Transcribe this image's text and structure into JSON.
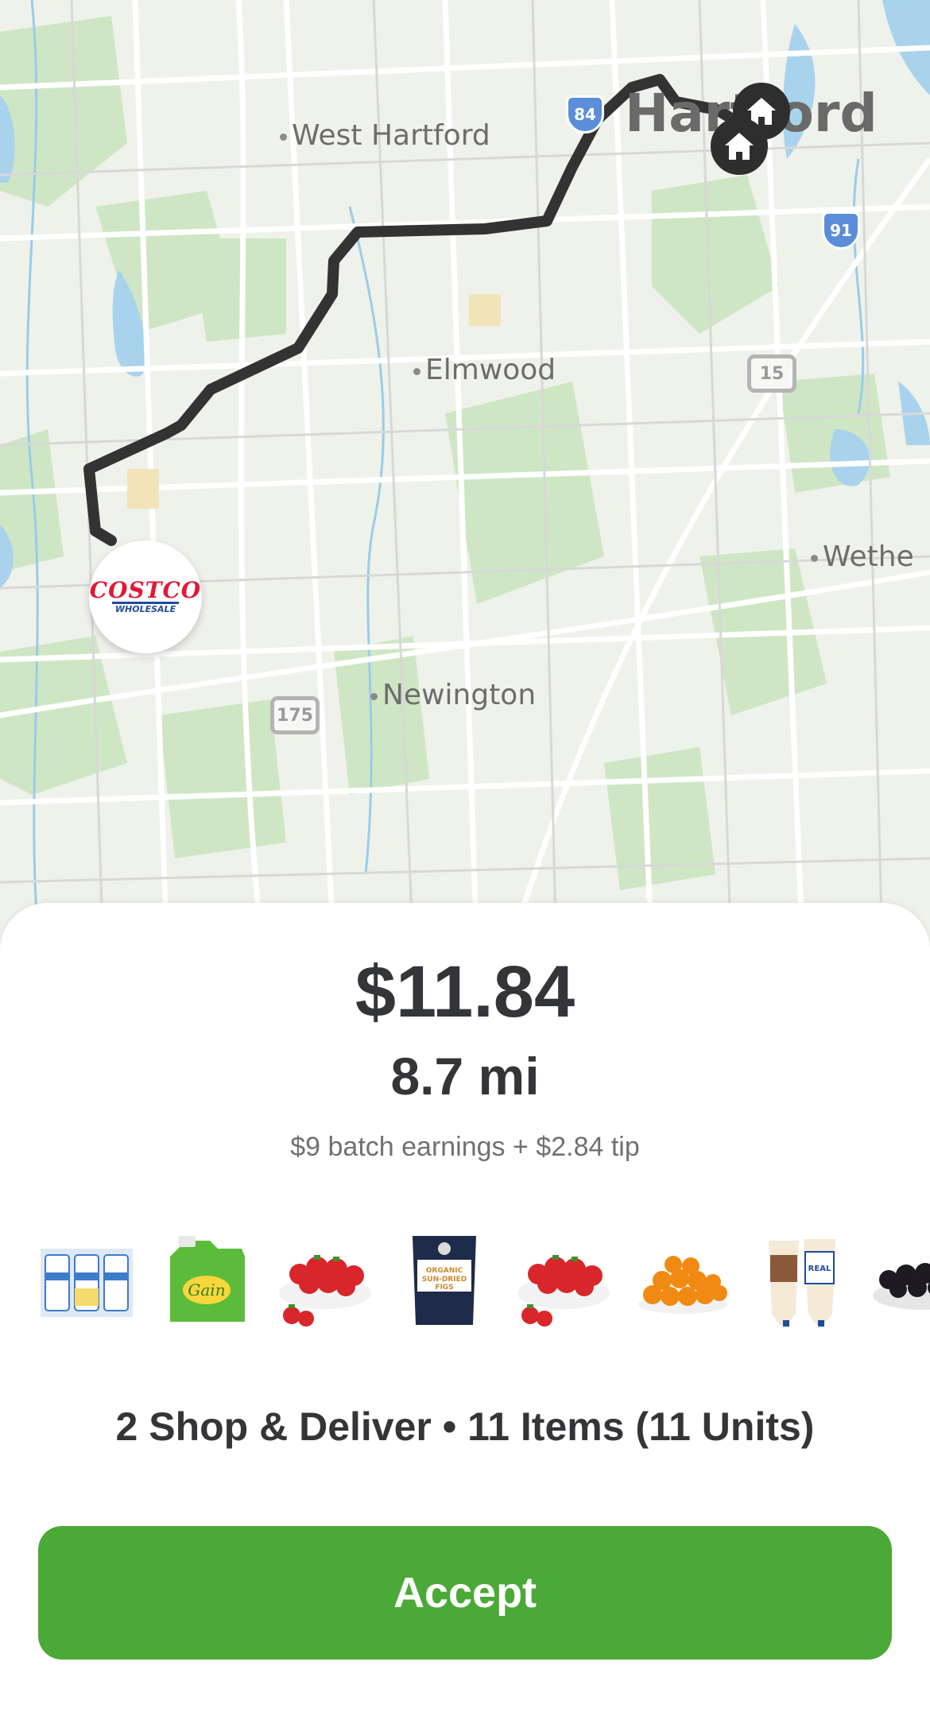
{
  "map": {
    "places": {
      "west_hartford": "West Hartford",
      "hartford": "Hartford",
      "elmwood": "Elmwood",
      "wethersfield": "Wethe",
      "newington": "Newington"
    },
    "route_shields": {
      "rt15": "15",
      "rt175": "175",
      "i91": "91",
      "i84": "84"
    },
    "store_logo": {
      "main": "COSTCO",
      "sub": "WHOLESALE"
    },
    "colors": {
      "route": "#333333",
      "water": "#a9d3ec",
      "park": "#c8e2bf"
    }
  },
  "offer": {
    "amount": "$11.84",
    "distance": "8.7 mi",
    "breakdown": "$9 batch earnings + $2.84 tip",
    "items": [
      {
        "icon": "cetaphil-lotion-pack-icon"
      },
      {
        "icon": "gain-detergent-icon"
      },
      {
        "icon": "strawberries-bowl-icon"
      },
      {
        "icon": "sun-dried-figs-bag-icon",
        "text": "ORGANIC SUN-DRIED FIGS"
      },
      {
        "icon": "strawberries-bowl-icon"
      },
      {
        "icon": "mandarin-oranges-icon"
      },
      {
        "icon": "hellmanns-mayonnaise-icon",
        "text": "REAL"
      },
      {
        "icon": "blackberries-bowl-icon"
      }
    ],
    "summary": "2 Shop & Deliver • 11 Items (11 Units)",
    "accept_label": "Accept",
    "accent_color": "#4ba937"
  }
}
